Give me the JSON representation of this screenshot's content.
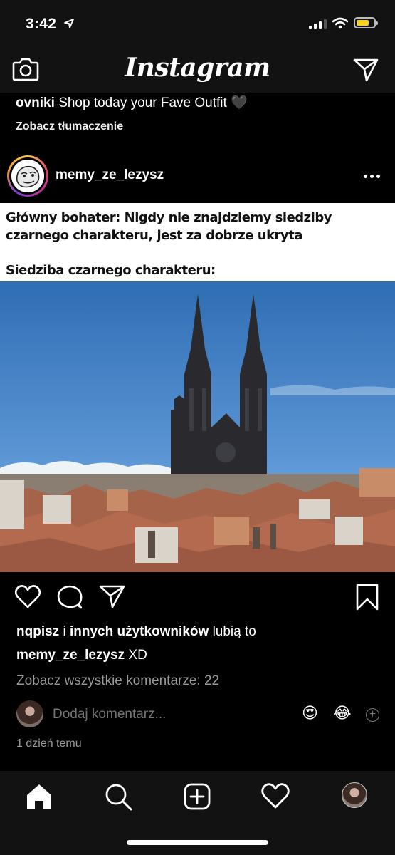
{
  "status": {
    "time": "3:42"
  },
  "header": {
    "title": "Instagram"
  },
  "previous_post": {
    "username": "ovniki",
    "caption": "Shop today your Fave Outfit 🖤",
    "translate_link": "Zobacz tłumaczenie"
  },
  "post": {
    "username": "memy_ze_lezysz",
    "meme_line1": "Główny bohater: Nigdy nie znajdziemy siedziby czarnego charakteru, jest za dobrze ukryta",
    "meme_line2": "Siedziba czarnego charakteru:",
    "likes": {
      "user": "nqpisz",
      "connector": "i",
      "others": "innych użytkowników",
      "suffix": "lubią to"
    },
    "caption_user": "memy_ze_lezysz",
    "caption_text": "XD",
    "view_comments": "Zobacz wszystkie komentarze: 22",
    "comment_placeholder": "Dodaj komentarz...",
    "quick_emojis": [
      "😍",
      "😂"
    ],
    "timestamp": "1 dzień temu"
  },
  "tab_bar": {
    "items": [
      "home-icon",
      "search-icon",
      "new-post-icon",
      "activity-heart-icon",
      "profile-avatar"
    ]
  },
  "colors": {
    "background": "#000000",
    "bar": "#121212",
    "muted": "#9a9a9a"
  }
}
